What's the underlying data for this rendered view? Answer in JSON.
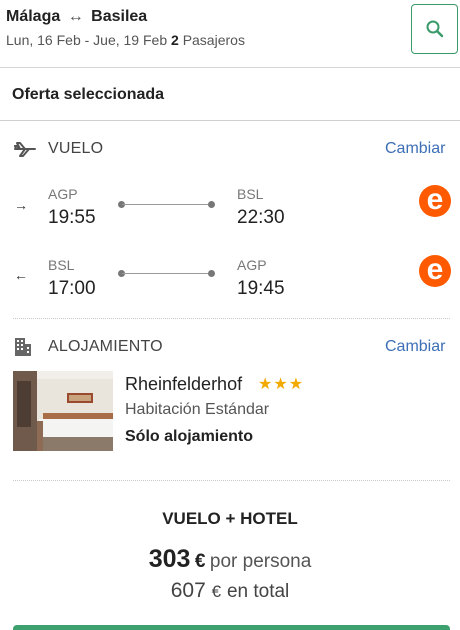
{
  "header": {
    "origin": "Málaga",
    "route_arrow": "↔",
    "destination": "Basilea",
    "dates": "Lun, 16 Feb - Jue, 19 Feb",
    "passengers_count": "2",
    "passengers_label": "Pasajeros",
    "search_icon": "search-icon"
  },
  "offer": {
    "title": "Oferta seleccionada"
  },
  "flight": {
    "label": "VUELO",
    "change_label": "Cambiar",
    "icon": "plane-icon",
    "outbound": {
      "direction_symbol": "→",
      "from_code": "AGP",
      "from_time": "19:55",
      "to_code": "BSL",
      "to_time": "22:30",
      "airline_logo_letter": "e"
    },
    "return": {
      "direction_symbol": "←",
      "from_code": "BSL",
      "from_time": "17:00",
      "to_code": "AGP",
      "to_time": "19:45",
      "airline_logo_letter": "e"
    },
    "airline_color": "#ff5a00"
  },
  "accommodation": {
    "label": "ALOJAMIENTO",
    "change_label": "Cambiar",
    "icon": "building-icon",
    "hotel_name": "Rheinfelderhof",
    "stars": "★★★",
    "room_type": "Habitación Estándar",
    "board": "Sólo alojamiento"
  },
  "price": {
    "title": "VUELO + HOTEL",
    "per_person_amount": "303",
    "currency": "€",
    "per_person_label": "por persona",
    "total_amount": "607",
    "total_label": "en total"
  },
  "colors": {
    "accent_green": "#3da06f",
    "link_blue": "#3d6fb6",
    "star_gold": "#f2a900"
  }
}
